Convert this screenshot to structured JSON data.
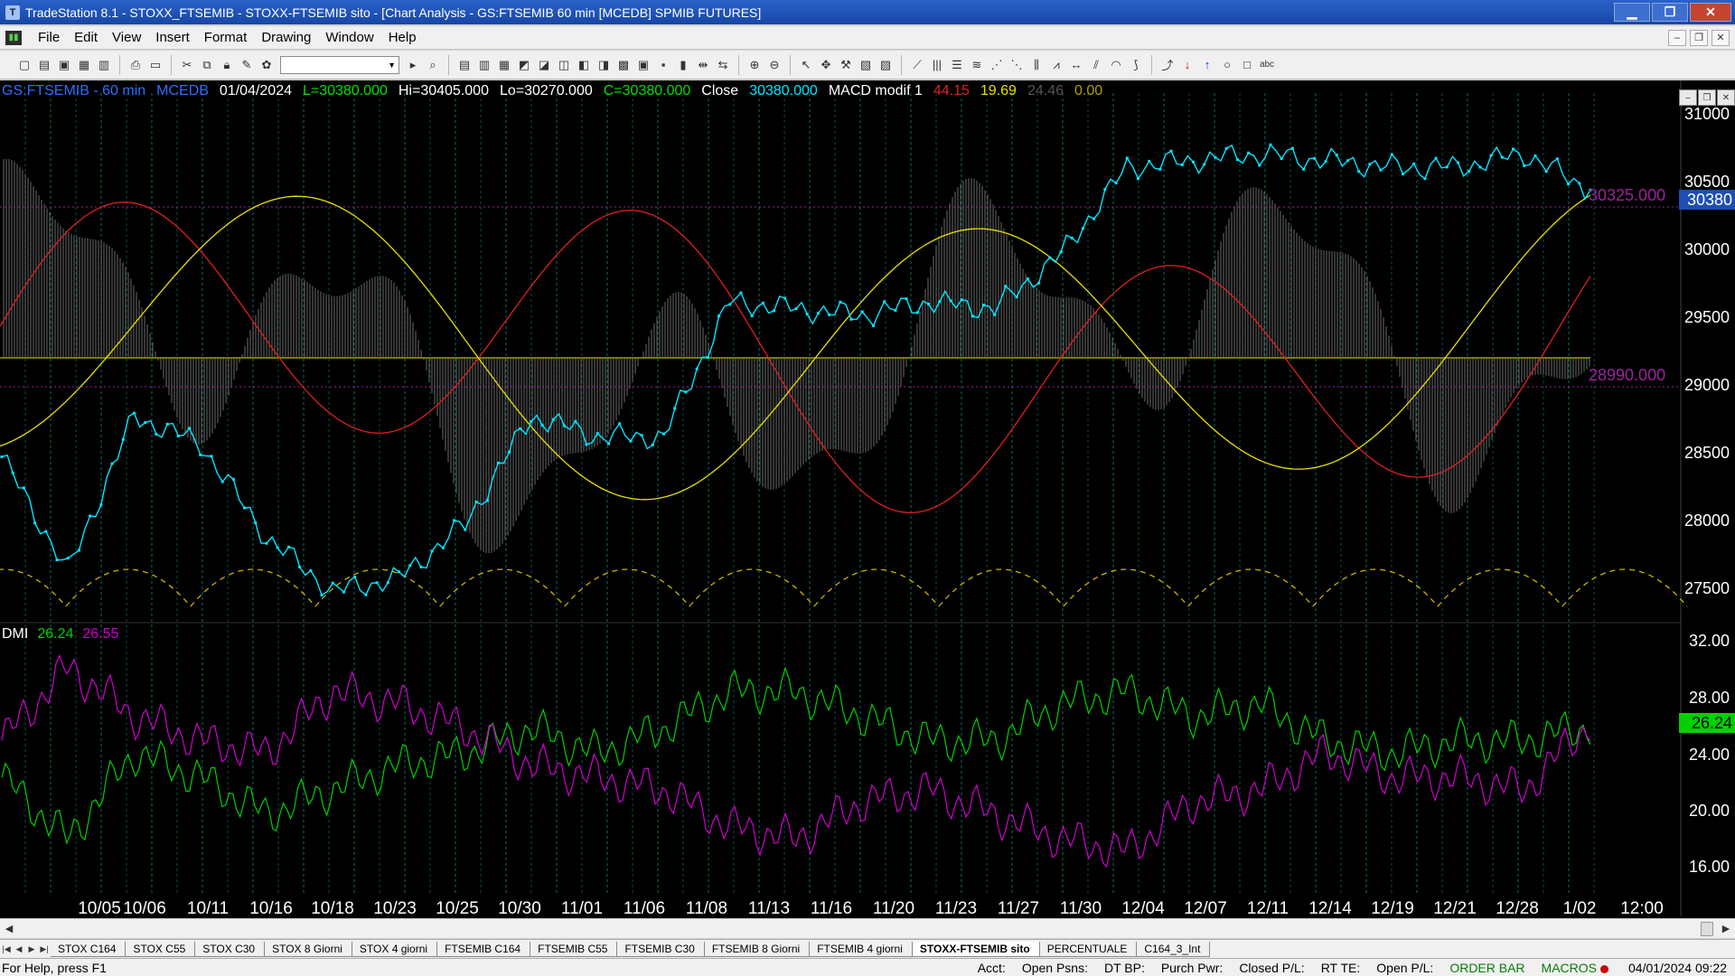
{
  "window": {
    "title": "TradeStation 8.1 - STOXX_FTSEMIB - STOXX-FTSEMIB sito - [Chart Analysis - GS:FTSEMIB  60 min  [MCEDB] SPMIB FUTURES]",
    "minimize": "▁",
    "maximize": "❐",
    "close": "✕"
  },
  "menu": {
    "items": [
      "File",
      "Edit",
      "View",
      "Insert",
      "Format",
      "Drawing",
      "Window",
      "Help"
    ],
    "mdi_buttons": [
      "–",
      "❐",
      "✕"
    ]
  },
  "toolbar": {
    "combo_value": "",
    "icons": [
      "new-icon",
      "open-icon",
      "save-icon",
      "save-all-icon",
      "save-workspace-icon",
      "print-icon",
      "print-preview-icon",
      "cut-icon",
      "copy-icon",
      "lock-icon",
      "format-icon",
      "settings-icon",
      "combo",
      "arrow-icon",
      "search-icon",
      "tool-1",
      "tool-2",
      "tool-3",
      "tool-4",
      "tool-5",
      "tool-6",
      "tool-7",
      "tool-8",
      "tool-9",
      "tool-10",
      "zoom-in-icon",
      "zoom-out-icon",
      "pointer-icon",
      "cursor-icon",
      "wrench-icon",
      "insert-icon",
      "draw-icon",
      "trendline-icon",
      "horizontal-line-icon",
      "fibonacci-icon",
      "text-icon",
      "circle-icon",
      "abc-icon"
    ]
  },
  "chart": {
    "symbol": "GS:FTSEMIB - 60 min",
    "source": "MCEDB",
    "date": "01/04/2024",
    "last": "L=30380.000",
    "high": "Hi=30405.000",
    "low": "Lo=30270.000",
    "close_val": "C=30380.000",
    "close_label": "Close",
    "close_price": "30380.000",
    "macd_label": "MACD modif 1",
    "macd_v1": "44.15",
    "macd_v2": "19.69",
    "macd_v3": "24.46",
    "macd_v4": "0.00",
    "hline1_label": "30325.000",
    "hline2_label": "28990.000",
    "price_tag": "30380",
    "price_axis": [
      "31000",
      "30500",
      "30000",
      "29500",
      "29000",
      "28500",
      "28000",
      "27500"
    ],
    "dmi": {
      "label": "DMI",
      "v1": "26.24",
      "v2": "26.55",
      "tag": "26.24",
      "axis": [
        "32.00",
        "28.00",
        "24.00",
        "20.00",
        "16.00"
      ]
    },
    "x_labels": [
      "10/05",
      "10/06",
      "10/11",
      "10/16",
      "10/18",
      "10/23",
      "10/25",
      "10/30",
      "11/01",
      "11/06",
      "11/08",
      "11/13",
      "11/16",
      "11/20",
      "11/23",
      "11/27",
      "11/30",
      "12/04",
      "12/07",
      "12/11",
      "12/14",
      "12/19",
      "12/21",
      "12/28",
      "1/02",
      "12:00"
    ],
    "colors": {
      "price": "#00e5ff",
      "red_line": "#e02020",
      "yellow_line": "#e8e000",
      "macd_hist": "#7a7a7a",
      "dmi_plus": "#00d000",
      "dmi_minus": "#d000d0",
      "grid": "#0d6b6b",
      "hline": "#a020a0"
    }
  },
  "chart_data": {
    "type": "line",
    "x": [
      "10/05",
      "10/06",
      "10/11",
      "10/16",
      "10/18",
      "10/23",
      "10/25",
      "10/30",
      "11/01",
      "11/06",
      "11/08",
      "11/13",
      "11/16",
      "11/20",
      "11/23",
      "11/27",
      "11/30",
      "12/04",
      "12/07",
      "12/11",
      "12/14",
      "12/19",
      "12/21",
      "12/28",
      "1/02"
    ],
    "series": [
      {
        "values": [
          28400,
          27550,
          28700,
          28500,
          27800,
          27400,
          27500,
          27900,
          28700,
          28550,
          28550,
          29550,
          29500,
          29450,
          29550,
          29500,
          29900,
          30550,
          30600,
          30650,
          30600,
          30550,
          30550,
          30650,
          30380
        ]
      }
    ],
    "ylim": [
      27250,
      31100
    ],
    "grid": true
  },
  "tabs": [
    "STOX C164",
    "STOX C55",
    "STOX  C30",
    "STOX  8 Giorni",
    "STOX 4 giorni",
    "FTSEMIB C164",
    "FTSEMIB C55",
    "FTSEMIB C30",
    "FTSEMIB  8 Giorni",
    "FTSEMIB  4 giorni",
    "STOXX-FTSEMIB sito",
    "PERCENTUALE",
    "C164_3_Int"
  ],
  "active_tab": "STOXX-FTSEMIB sito",
  "status": {
    "help": "For Help, press F1",
    "acct": "Acct:",
    "open_psns": "Open Psns:",
    "dt_bp": "DT BP:",
    "purch_pwr": "Purch Pwr:",
    "closed_pl": "Closed P/L:",
    "rt_te": "RT TE:",
    "open_pl": "Open P/L:",
    "order_bar": "ORDER BAR",
    "macros": "MACROS",
    "datetime": "04/01/2024 09:22"
  }
}
